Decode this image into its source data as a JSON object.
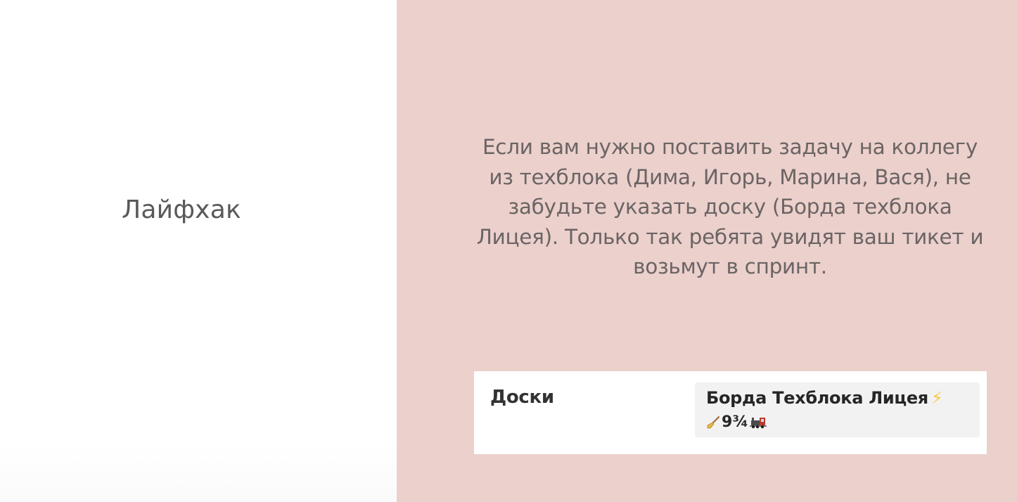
{
  "slide": {
    "title": "Лайфхак",
    "body": "Если вам нужно поставить задачу на коллегу из техблока (Дима, Игорь, Марина, Вася), не забудьте указать доску (Борда техблока Лицея). Только так ребята увидят ваш тикет и возьмут в спринт."
  },
  "field": {
    "label": "Доски",
    "value_line1": "Борда Техблока Лицея",
    "value_line2": "9¾",
    "icons": [
      "lightning-icon",
      "broom-icon",
      "train-icon"
    ]
  },
  "colors": {
    "right_panel_bg": "#ebd0cc",
    "title_text": "#595959",
    "body_text": "#6b6464",
    "lightning": "#f6c945"
  }
}
